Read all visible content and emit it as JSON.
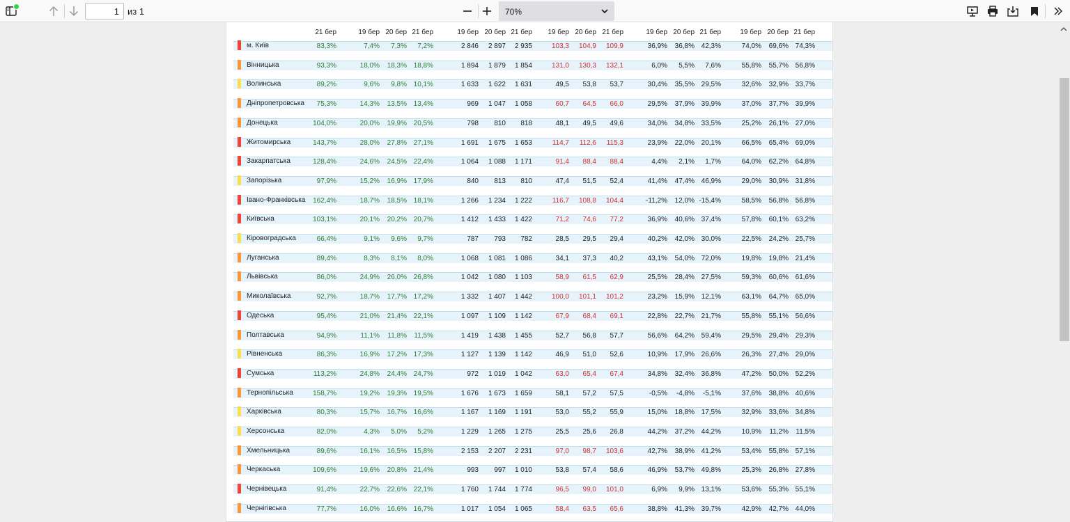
{
  "toolbar": {
    "page_number": "1",
    "page_count": "из 1",
    "zoom": "70%"
  },
  "table": {
    "headers": [
      "21 бер",
      "19 бер",
      "20 бер",
      "21 бер",
      "19 бер",
      "20 бер",
      "21 бер",
      "19 бер",
      "20 бер",
      "21 бер",
      "19 бер",
      "20 бер",
      "21 бер",
      "19 бер",
      "20 бер",
      "21 бер"
    ],
    "colors": {
      "red": "#f44336",
      "orange": "#ff9433",
      "yellow": "#fbde49",
      "green_text": "#2e7d32",
      "red_text": "#d32f2f"
    },
    "rows": [
      {
        "name": "м. Київ",
        "level": "red",
        "v": [
          "83,3%",
          "7,4%",
          "7,3%",
          "7,2%",
          "2 846",
          "2 897",
          "2 935",
          "103,3",
          "104,9",
          "109,9",
          "36,9%",
          "36,8%",
          "42,3%",
          "74,0%",
          "69,6%",
          "74,3%"
        ],
        "red": true
      },
      {
        "name": "Вінницька",
        "level": "orange",
        "v": [
          "93,3%",
          "18,0%",
          "18,3%",
          "18,8%",
          "1 894",
          "1 879",
          "1 854",
          "131,0",
          "130,3",
          "132,1",
          "6,0%",
          "5,5%",
          "7,6%",
          "55,8%",
          "55,7%",
          "56,8%"
        ],
        "red": true
      },
      {
        "name": "Волинська",
        "level": "yellow",
        "v": [
          "89,2%",
          "9,6%",
          "9,8%",
          "10,1%",
          "1 633",
          "1 622",
          "1 631",
          "49,5",
          "53,8",
          "53,7",
          "30,4%",
          "35,5%",
          "29,5%",
          "32,6%",
          "32,9%",
          "33,7%"
        ],
        "red": false
      },
      {
        "name": "Дніпропетровська",
        "level": "orange",
        "v": [
          "75,3%",
          "14,3%",
          "13,5%",
          "13,4%",
          "969",
          "1 047",
          "1 058",
          "60,7",
          "64,5",
          "66,0",
          "29,5%",
          "37,9%",
          "39,9%",
          "37,0%",
          "37,7%",
          "39,9%"
        ],
        "red": true
      },
      {
        "name": "Донецька",
        "level": "orange",
        "v": [
          "104,0%",
          "20,0%",
          "19,9%",
          "20,5%",
          "798",
          "810",
          "818",
          "48,1",
          "49,5",
          "49,6",
          "34,0%",
          "34,8%",
          "33,5%",
          "25,2%",
          "26,1%",
          "27,0%"
        ],
        "red": false
      },
      {
        "name": "Житомирська",
        "level": "red",
        "v": [
          "143,7%",
          "28,0%",
          "27,8%",
          "27,1%",
          "1 691",
          "1 675",
          "1 653",
          "114,7",
          "112,6",
          "115,3",
          "23,9%",
          "22,0%",
          "20,1%",
          "66,5%",
          "65,4%",
          "69,0%"
        ],
        "red": true
      },
      {
        "name": "Закарпатська",
        "level": "red",
        "v": [
          "128,4%",
          "24,6%",
          "24,5%",
          "22,4%",
          "1 064",
          "1 088",
          "1 171",
          "91,4",
          "88,4",
          "88,4",
          "4,4%",
          "2,1%",
          "1,7%",
          "64,0%",
          "62,2%",
          "64,8%"
        ],
        "red": true
      },
      {
        "name": "Запорізька",
        "level": "yellow",
        "v": [
          "97,9%",
          "15,2%",
          "16,9%",
          "17,9%",
          "840",
          "813",
          "810",
          "47,4",
          "51,5",
          "52,4",
          "41,4%",
          "47,4%",
          "46,9%",
          "29,0%",
          "30,9%",
          "31,8%"
        ],
        "red": false
      },
      {
        "name": "Івано-Франківська",
        "level": "red",
        "v": [
          "162,4%",
          "18,7%",
          "18,5%",
          "18,1%",
          "1 266",
          "1 234",
          "1 222",
          "116,7",
          "108,8",
          "104,4",
          "-11,2%",
          "12,0%",
          "-15,4%",
          "58,5%",
          "56,8%",
          "56,8%"
        ],
        "red": true
      },
      {
        "name": "Київська",
        "level": "red",
        "v": [
          "103,1%",
          "20,1%",
          "20,2%",
          "20,7%",
          "1 412",
          "1 433",
          "1 422",
          "71,2",
          "74,6",
          "77,2",
          "36,9%",
          "40,6%",
          "37,4%",
          "57,8%",
          "60,1%",
          "63,2%"
        ],
        "red": true
      },
      {
        "name": "Кіровоградська",
        "level": "yellow",
        "v": [
          "66,4%",
          "9,1%",
          "9,6%",
          "9,7%",
          "787",
          "793",
          "782",
          "28,5",
          "29,5",
          "29,4",
          "40,2%",
          "42,0%",
          "30,0%",
          "22,5%",
          "24,2%",
          "25,7%"
        ],
        "red": false
      },
      {
        "name": "Луганська",
        "level": "orange",
        "v": [
          "89,4%",
          "8,3%",
          "8,1%",
          "8,0%",
          "1 068",
          "1 081",
          "1 086",
          "34,1",
          "37,3",
          "40,2",
          "43,1%",
          "54,0%",
          "72,0%",
          "19,8%",
          "19,8%",
          "21,4%"
        ],
        "red": false
      },
      {
        "name": "Львівська",
        "level": "orange",
        "v": [
          "86,0%",
          "24,9%",
          "26,0%",
          "26,8%",
          "1 042",
          "1 080",
          "1 103",
          "58,9",
          "61,5",
          "62,9",
          "25,5%",
          "28,4%",
          "27,5%",
          "59,3%",
          "60,6%",
          "61,6%"
        ],
        "red": true
      },
      {
        "name": "Миколаївська",
        "level": "orange",
        "v": [
          "92,7%",
          "18,7%",
          "17,7%",
          "17,2%",
          "1 332",
          "1 407",
          "1 442",
          "100,0",
          "101,1",
          "101,2",
          "23,2%",
          "15,9%",
          "12,1%",
          "63,1%",
          "64,7%",
          "65,0%"
        ],
        "red": true
      },
      {
        "name": "Одеська",
        "level": "red",
        "v": [
          "95,4%",
          "21,0%",
          "21,4%",
          "22,1%",
          "1 097",
          "1 109",
          "1 142",
          "67,9",
          "68,4",
          "69,1",
          "22,8%",
          "22,7%",
          "21,7%",
          "55,8%",
          "55,1%",
          "56,6%"
        ],
        "red": true
      },
      {
        "name": "Полтавська",
        "level": "orange",
        "v": [
          "94,9%",
          "11,1%",
          "11,8%",
          "11,5%",
          "1 419",
          "1 438",
          "1 455",
          "52,7",
          "56,8",
          "57,7",
          "56,6%",
          "64,2%",
          "59,4%",
          "29,5%",
          "29,4%",
          "29,3%"
        ],
        "red": false
      },
      {
        "name": "Рівненська",
        "level": "yellow",
        "v": [
          "86,3%",
          "16,9%",
          "17,2%",
          "17,3%",
          "1 127",
          "1 139",
          "1 142",
          "46,9",
          "51,0",
          "52,6",
          "10,9%",
          "17,9%",
          "26,6%",
          "26,3%",
          "27,4%",
          "29,0%"
        ],
        "red": false
      },
      {
        "name": "Сумська",
        "level": "red",
        "v": [
          "113,2%",
          "24,8%",
          "24,4%",
          "24,7%",
          "972",
          "1 019",
          "1 042",
          "63,0",
          "65,4",
          "67,4",
          "34,8%",
          "32,4%",
          "36,8%",
          "47,2%",
          "50,0%",
          "52,2%"
        ],
        "red": true
      },
      {
        "name": "Тернопільська",
        "level": "orange",
        "v": [
          "158,7%",
          "19,2%",
          "19,3%",
          "19,5%",
          "1 676",
          "1 673",
          "1 659",
          "58,1",
          "57,2",
          "57,5",
          "-0,5%",
          "-4,8%",
          "-5,1%",
          "37,6%",
          "38,8%",
          "40,6%"
        ],
        "red": false
      },
      {
        "name": "Харківська",
        "level": "yellow",
        "v": [
          "80,3%",
          "15,7%",
          "16,7%",
          "16,6%",
          "1 167",
          "1 169",
          "1 191",
          "53,0",
          "55,2",
          "55,9",
          "15,0%",
          "18,8%",
          "17,5%",
          "32,9%",
          "33,6%",
          "34,8%"
        ],
        "red": false
      },
      {
        "name": "Херсонська",
        "level": "yellow",
        "v": [
          "82,0%",
          "4,3%",
          "5,0%",
          "5,2%",
          "1 229",
          "1 265",
          "1 275",
          "25,5",
          "25,6",
          "26,8",
          "44,2%",
          "37,2%",
          "44,2%",
          "10,9%",
          "11,2%",
          "11,5%"
        ],
        "red": false
      },
      {
        "name": "Хмельницька",
        "level": "orange",
        "v": [
          "89,6%",
          "16,1%",
          "16,5%",
          "15,8%",
          "2 153",
          "2 207",
          "2 231",
          "97,0",
          "98,7",
          "103,6",
          "42,7%",
          "38,9%",
          "41,2%",
          "53,4%",
          "55,8%",
          "57,1%"
        ],
        "red": true
      },
      {
        "name": "Черкаська",
        "level": "orange",
        "v": [
          "109,6%",
          "19,6%",
          "20,8%",
          "21,4%",
          "993",
          "997",
          "1 010",
          "53,8",
          "57,4",
          "58,6",
          "46,9%",
          "53,7%",
          "49,8%",
          "25,3%",
          "26,8%",
          "27,8%"
        ],
        "red": false
      },
      {
        "name": "Чернівецька",
        "level": "red",
        "v": [
          "91,4%",
          "22,7%",
          "22,6%",
          "22,1%",
          "1 760",
          "1 744",
          "1 774",
          "96,5",
          "99,0",
          "101,0",
          "6,9%",
          "9,9%",
          "13,1%",
          "53,6%",
          "55,3%",
          "55,1%"
        ],
        "red": true
      },
      {
        "name": "Чернігівська",
        "level": "orange",
        "v": [
          "77,7%",
          "16,0%",
          "16,6%",
          "16,7%",
          "1 017",
          "1 054",
          "1 065",
          "58,4",
          "63,5",
          "65,6",
          "38,8%",
          "41,3%",
          "39,7%",
          "42,9%",
          "42,7%",
          "44,0%"
        ],
        "red": true
      }
    ]
  }
}
